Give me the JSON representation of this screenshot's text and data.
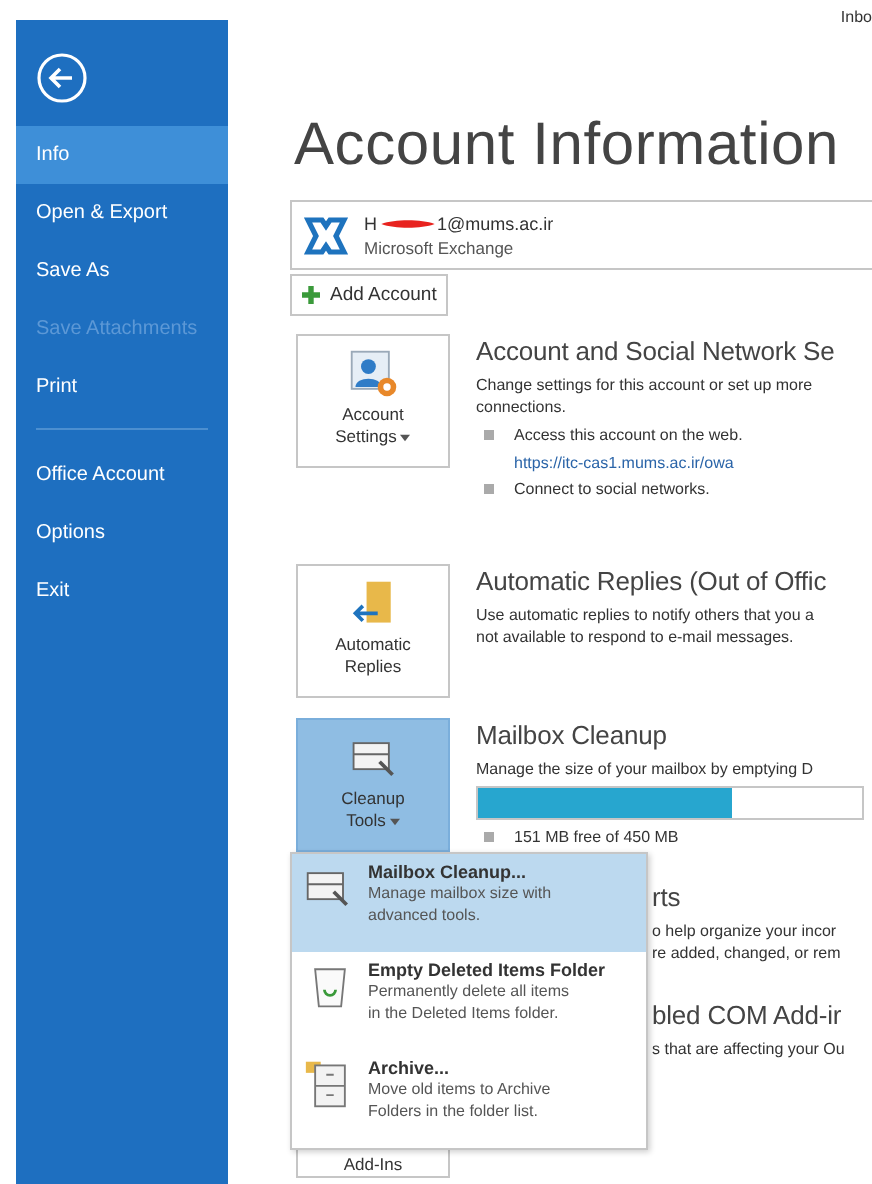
{
  "top_bar": {
    "title": "Inbo"
  },
  "sidebar": {
    "items": [
      {
        "label": "Info",
        "selected": true,
        "disabled": false
      },
      {
        "label": "Open & Export",
        "selected": false,
        "disabled": false
      },
      {
        "label": "Save As",
        "selected": false,
        "disabled": false
      },
      {
        "label": "Save Attachments",
        "selected": false,
        "disabled": true
      },
      {
        "label": "Print",
        "selected": false,
        "disabled": false,
        "separator_after": true
      },
      {
        "label": "Office Account",
        "selected": false,
        "disabled": false
      },
      {
        "label": "Options",
        "selected": false,
        "disabled": false
      },
      {
        "label": "Exit",
        "selected": false,
        "disabled": false
      }
    ]
  },
  "title": "Account Information",
  "account": {
    "email_start": "H",
    "email_end": "1@mums.ac.ir",
    "type": "Microsoft Exchange"
  },
  "add_account": "Add Account",
  "sections": [
    {
      "kind": "settings",
      "tile": [
        "Account",
        "Settings"
      ],
      "dropdown": true,
      "selected": false,
      "heading": "Account and Social Network Se",
      "lines": [
        "Change settings for this account or set up more",
        "connections."
      ],
      "bullets": [
        {
          "text": "Access this account on the web.",
          "link": "https://itc-cas1.mums.ac.ir/owa"
        },
        {
          "text": "Connect to social networks."
        }
      ]
    },
    {
      "kind": "replies",
      "tile": [
        "Automatic",
        "Replies"
      ],
      "dropdown": false,
      "selected": false,
      "heading": "Automatic Replies (Out of Offic",
      "lines": [
        "Use automatic replies to notify others that you a",
        "not available to respond to e-mail messages."
      ]
    },
    {
      "kind": "cleanup",
      "tile": [
        "Cleanup",
        "Tools"
      ],
      "dropdown": true,
      "selected": true,
      "heading": "Mailbox Cleanup",
      "lines": [
        "Manage the size of your mailbox by emptying D"
      ],
      "level": 0.66,
      "bullets": [
        {
          "text": "151 MB free of 450 MB"
        }
      ]
    },
    {
      "kind": "covered",
      "heading": "rts",
      "lines": [
        "o help organize your incor",
        "re added, changed, or rem"
      ]
    },
    {
      "kind": "covered",
      "heading": "bled COM Add-ir",
      "lines": [
        "s that are affecting your Ou"
      ],
      "tile_bottom": "Add-Ins"
    }
  ],
  "menu": {
    "items": [
      {
        "kind": "cleanup",
        "title": "Mailbox Cleanup...",
        "description": [
          "Manage mailbox size with",
          "advanced tools."
        ],
        "selected": true
      },
      {
        "kind": "trash",
        "title": "Empty Deleted Items Folder",
        "description": [
          "Permanently delete all items",
          "in the Deleted Items folder."
        ],
        "selected": false
      },
      {
        "kind": "archive",
        "title": "Archive...",
        "description": [
          "Move old items to Archive",
          "Folders in the folder list."
        ],
        "selected": false
      }
    ]
  }
}
